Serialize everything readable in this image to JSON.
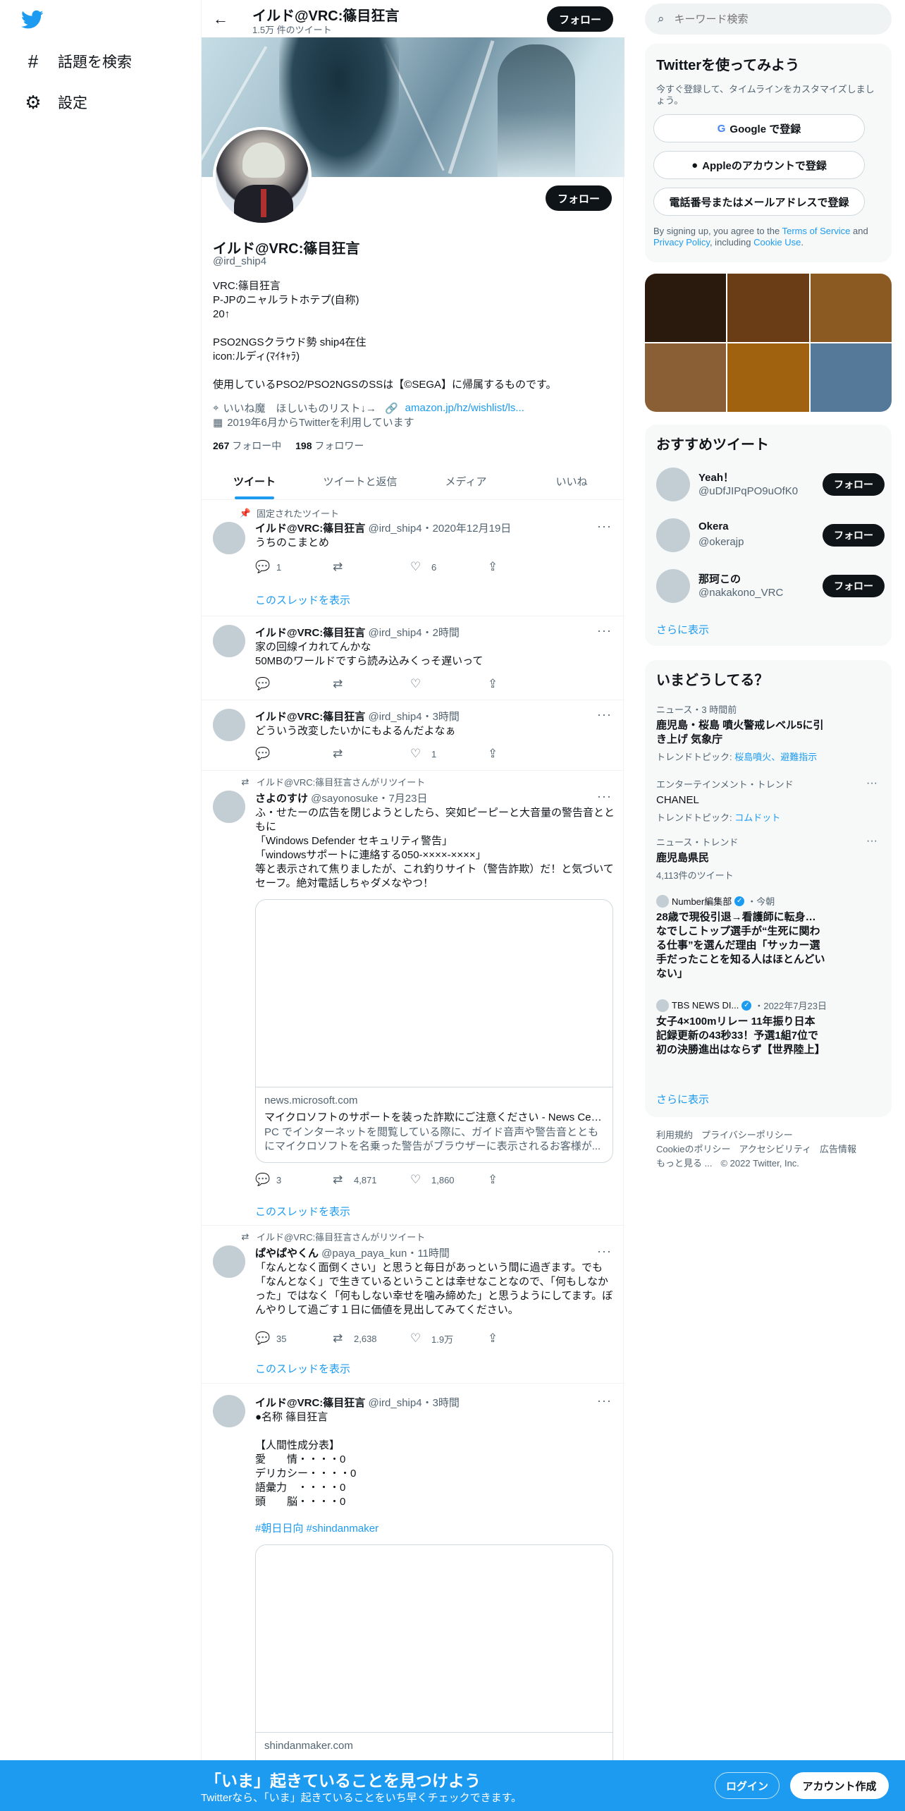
{
  "nav": {
    "explore_label": "話題を検索",
    "settings_label": "設定"
  },
  "header": {
    "name": "イルド@VRC:篠目狂言",
    "tweet_count": "1.5万 件のツイート",
    "follow_label": "フォロー"
  },
  "profile": {
    "name": "イルド@VRC:篠目狂言",
    "handle": "@ird_ship4",
    "follow_label": "フォロー",
    "bio": "VRC:篠目狂言\nP-JPのニャルラトホテプ(自称)\n20↑\n\nPSO2NGSクラウド勢 ship4在住\nicon:ルディ(ﾏｲｷｬﾗ)\n\n使用しているPSO2/PSO2NGSのSSは【©SEGA】に帰属するものです。",
    "location": "いいね魔　ほしいものリスト↓→",
    "link": "amazon.jp/hz/wishlist/ls...",
    "joined": "2019年6月からTwitterを利用しています",
    "following_count": "267",
    "following_label": " フォロー中",
    "followers_count": "198",
    "followers_label": " フォロワー"
  },
  "tabs": [
    "ツイート",
    "ツイートと返信",
    "メディア",
    "いいね"
  ],
  "tweets": [
    {
      "context": "固定されたツイート",
      "name": "イルド@VRC:篠目狂言",
      "meta": " @ird_ship4・2020年12月19日",
      "text": "うちのこまとめ",
      "reply": "1",
      "retweet": "",
      "like": "6",
      "show_thread": "このスレッドを表示"
    },
    {
      "name": "イルド@VRC:篠目狂言",
      "meta": " @ird_ship4・2時間",
      "text": "家の回線イカれてんかな\n50MBのワールドですら読み込みくっそ遅いって",
      "reply": "",
      "retweet": "",
      "like": ""
    },
    {
      "name": "イルド@VRC:篠目狂言",
      "meta": " @ird_ship4・3時間",
      "text": "どういう改変したいかにもよるんだよなぁ",
      "reply": "",
      "retweet": "",
      "like": "1"
    },
    {
      "context": "イルド@VRC:篠目狂言さんがリツイート",
      "name": "さよのすけ",
      "meta": " @sayonosuke・7月23日",
      "text": "ふ・せたーの広告を閉じようとしたら、突如ピーピーと大音量の警告音とともに\n「Windows Defender セキュリティ警告」\n「windowsサポートに連絡する050-××××-××××」\n等と表示されて焦りましたが、これ釣りサイト（警告詐欺）だ！と気づいてセーフ。絶対電話しちゃダメなやつ！",
      "card_domain": "news.microsoft.com",
      "card_title": "マイクロソフトのサポートを装った詐欺にご注意ください - News Center Japan",
      "card_desc": "PC でインターネットを閲覧している際に、ガイド音声や警告音とともにマイクロソフトを名乗った警告がブラウザーに表示されるお客様が...",
      "reply": "3",
      "retweet": "4,871",
      "like": "1,860",
      "show_thread": "このスレッドを表示"
    },
    {
      "context": "イルド@VRC:篠目狂言さんがリツイート",
      "name": "ぱやぱやくん",
      "meta": " @paya_paya_kun・11時間",
      "text": "「なんとなく面倒くさい」と思うと毎日があっという間に過ぎます。でも「なんとなく」で生きているということは幸せなことなので、「何もしなかった」ではなく「何もしない幸せを噛み締めた」と思うようにしてます。ぼんやりして過ごす１日に価値を見出してみてください。",
      "reply": "35",
      "retweet": "2,638",
      "like": "1.9万",
      "show_thread": "このスレッドを表示"
    },
    {
      "name": "イルド@VRC:篠目狂言",
      "meta": " @ird_ship4・3時間",
      "text": "●名称 篠目狂言\n\n【人間性成分表】\n愛　　情・・・・0\nデリカシー・・・・0\n語彙力　・・・・0\n頭　　脳・・・・0",
      "hashtags": "#朝日日向 #shindanmaker",
      "card_domain": "shindanmaker.com"
    }
  ],
  "search": {
    "placeholder": "キーワード検索"
  },
  "signup": {
    "title": "Twitterを使ってみよう",
    "subtitle": "今すぐ登録して、タイムラインをカスタマイズしましょう。",
    "google": "Google で登録",
    "apple": "Appleのアカウントで登録",
    "phone": "電話番号またはメールアドレスで登録",
    "legal_prefix": "By signing up, you agree to the ",
    "tos": "Terms of Service",
    "and": " and ",
    "privacy": "Privacy Policy",
    "including": ", including ",
    "cookie": "Cookie Use",
    "period": "."
  },
  "media_colors": [
    "#2a190d",
    "#6b3d16",
    "#8a5a22",
    "#8b5f36",
    "#a0620f",
    "#557a99"
  ],
  "who_to_follow": {
    "title": "おすすめツイート",
    "users": [
      {
        "name": "Yeah！",
        "handle": "@uDfJIPqPO9uOfK0"
      },
      {
        "name": "Okera",
        "handle": "@okerajp"
      },
      {
        "name": "那珂この",
        "handle": "@nakakono_VRC"
      }
    ],
    "follow_label": "フォロー",
    "more": "さらに表示"
  },
  "trends": {
    "title": "いまどうしてる？",
    "items": [
      {
        "cat": "ニュース・3 時間前",
        "title": "鹿児島・桜島 噴火警戒レベル5に引き上げ 気象庁",
        "rel_prefix": "トレンドトピック: ",
        "rel": "桜島噴火、避難指示"
      },
      {
        "cat": "エンターテインメント・トレンド",
        "title": "CHANEL",
        "rel_prefix": "トレンドトピック: ",
        "rel": "コムドット"
      },
      {
        "cat": "ニュース・トレンド",
        "title": "鹿児島県民",
        "count": "4,113件のツイート"
      },
      {
        "src": "Number編集部",
        "time": "・今朝",
        "title": "28歳で現役引退→看護師に転身…なでしこトップ選手が“生死に関わる仕事”を選んだ理由「サッカー選手だったことを知る人はほとんどいない」"
      },
      {
        "src": "TBS NEWS DI...",
        "time": "・2022年7月23日",
        "title": "女子4×100mリレー 11年振り日本記録更新の43秒33！予選1組7位で初の決勝進出はならず【世界陸上】"
      }
    ],
    "more": "さらに表示"
  },
  "footer": {
    "links": [
      "利用規約",
      "プライバシーポリシー",
      "Cookieのポリシー",
      "アクセシビリティ",
      "広告情報",
      "もっと見る ...",
      "© 2022 Twitter, Inc."
    ]
  },
  "bottom_bar": {
    "title": "「いま」起きていることを見つけよう",
    "subtitle": "Twitterなら、「いま」起きていることをいち早くチェックできます。",
    "login": "ログイン",
    "signup": "アカウント作成"
  },
  "colors": {
    "accent": "#1d9bf0",
    "text": "#0f1419",
    "muted": "#536471"
  }
}
